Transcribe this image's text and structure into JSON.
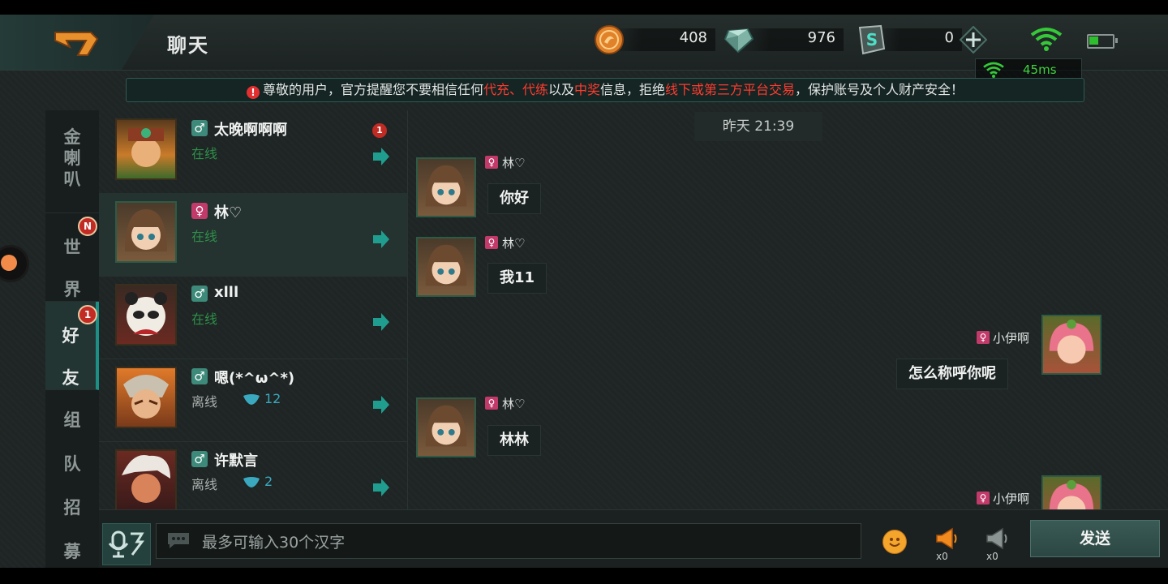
{
  "header": {
    "title": "聊天",
    "currencies": [
      {
        "icon": "gold-coin-icon",
        "value": "408"
      },
      {
        "icon": "diamond-icon",
        "value": "976"
      },
      {
        "icon": "voucher-icon",
        "value": "0"
      }
    ],
    "ping": "45ms"
  },
  "notice": {
    "part1": "尊敬的用户，官方提醒您不要相信任何",
    "red1": "代充、代练",
    "part2": "以及",
    "red2": "中奖",
    "part3": "信息，拒绝",
    "red3": "线下或第三方平台交易",
    "part4": "，保护账号及个人财产安全！"
  },
  "tabs": [
    {
      "label": "金喇叭"
    },
    {
      "label": "世界",
      "badge": "N"
    },
    {
      "label": "好友",
      "badge": "1"
    },
    {
      "label": "组队招募"
    }
  ],
  "friends": [
    {
      "name": "太晚啊啊啊",
      "gender": "♂",
      "status": "在线",
      "unread": "1"
    },
    {
      "name": "林♡",
      "gender": "♀",
      "status": "在线"
    },
    {
      "name": "xlll",
      "gender": "♂",
      "status": "在线"
    },
    {
      "name": "嗯(*^ω^*)",
      "gender": "♂",
      "status": "离线",
      "intimacy": "12"
    },
    {
      "name": "许默言",
      "gender": "♂",
      "status": "离线",
      "intimacy": "2"
    }
  ],
  "chat": {
    "timestamp": "昨天 21:39",
    "messages": [
      {
        "sender": "林♡",
        "gender": "♀",
        "text": "你好",
        "side": "left"
      },
      {
        "sender": "林♡",
        "gender": "♀",
        "text": "我11",
        "side": "left"
      },
      {
        "sender": "小伊啊",
        "gender": "♀",
        "text": "怎么称呼你呢",
        "side": "right"
      },
      {
        "sender": "林♡",
        "gender": "♀",
        "text": "林林",
        "side": "left"
      },
      {
        "sender": "小伊啊",
        "gender": "♀",
        "text": "",
        "side": "right"
      }
    ]
  },
  "input": {
    "placeholder": "最多可输入30个汉字",
    "horn_gold_count": "x0",
    "horn_silver_count": "x0",
    "send_label": "发送"
  }
}
